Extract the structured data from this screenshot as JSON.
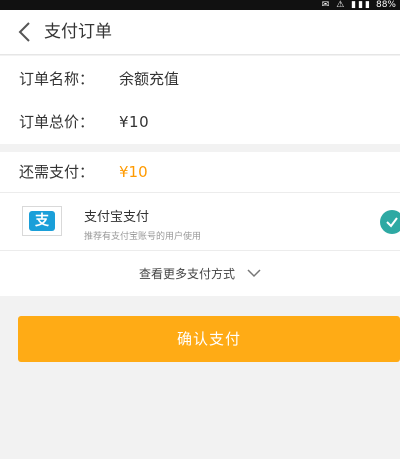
{
  "status_bar": {
    "icons": "✉ ⚠ ▮▮▮",
    "battery": "88%"
  },
  "header": {
    "title": "支付订单"
  },
  "order": {
    "name_label": "订单名称：",
    "name_value": "余额充值",
    "total_label": "订单总价：",
    "total_value": "¥10"
  },
  "payment": {
    "need_label": "还需支付：",
    "need_value": "¥10",
    "method": {
      "logo_char": "支",
      "name": "支付宝支付",
      "description": "推荐有支付宝账号的用户使用",
      "selected": true
    },
    "more_methods_label": "查看更多支付方式"
  },
  "actions": {
    "confirm_label": "确认支付"
  },
  "colors": {
    "accent": "#ffab15",
    "price": "#ff9a00",
    "alipay_blue": "#1a9fd9",
    "check_teal": "#2ea9a3"
  }
}
